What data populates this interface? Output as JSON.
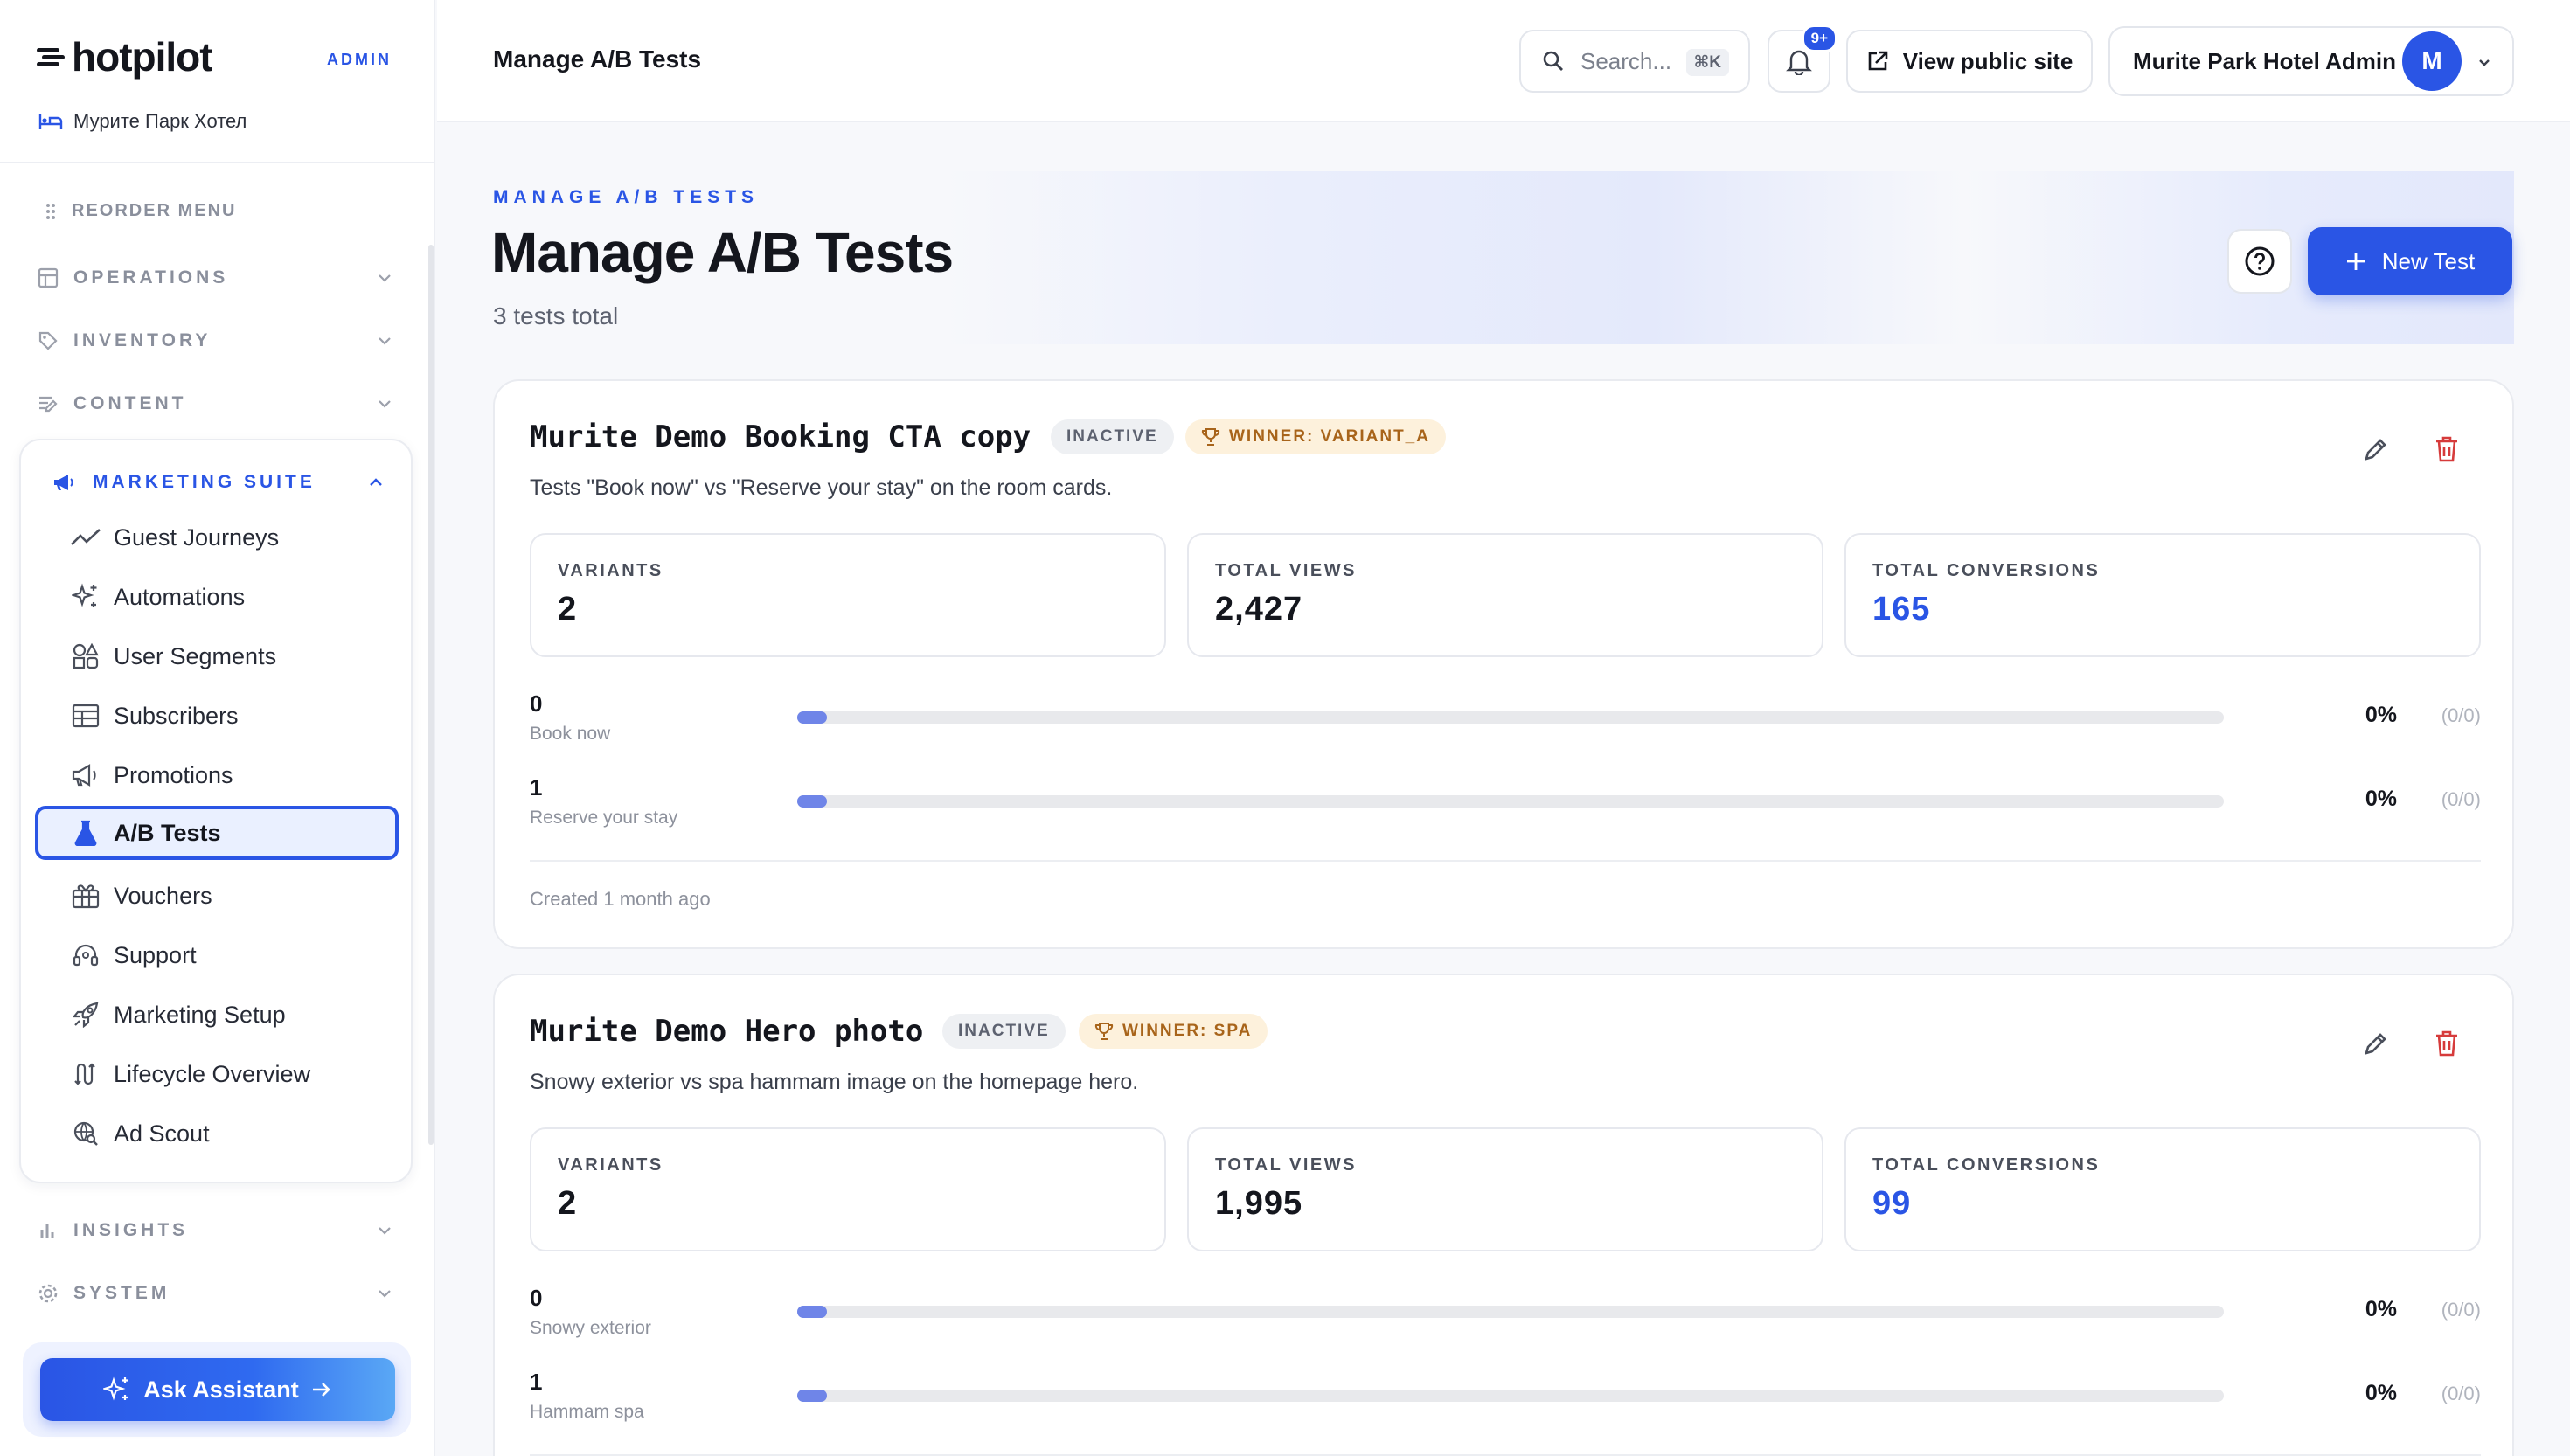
{
  "sidebar": {
    "brand": "hotpilot",
    "admin_tag": "ADMIN",
    "hotel_name": "Мурите Парк Хотел",
    "reorder_label": "REORDER MENU",
    "sections": {
      "operations": "OPERATIONS",
      "inventory": "INVENTORY",
      "content": "CONTENT",
      "marketing": "MARKETING SUITE",
      "insights": "INSIGHTS",
      "system": "SYSTEM"
    },
    "marketing_items": [
      {
        "label": "Guest Journeys",
        "icon": "trend-icon"
      },
      {
        "label": "Automations",
        "icon": "sparkles-icon"
      },
      {
        "label": "User Segments",
        "icon": "shapes-icon"
      },
      {
        "label": "Subscribers",
        "icon": "table-icon"
      },
      {
        "label": "Promotions",
        "icon": "megaphone-icon"
      },
      {
        "label": "A/B Tests",
        "icon": "flask-icon",
        "active": true
      },
      {
        "label": "Vouchers",
        "icon": "gift-icon"
      },
      {
        "label": "Support",
        "icon": "headset-icon"
      },
      {
        "label": "Marketing Setup",
        "icon": "rocket-icon"
      },
      {
        "label": "Lifecycle Overview",
        "icon": "loop-icon"
      },
      {
        "label": "Ad Scout",
        "icon": "search-globe-icon"
      }
    ],
    "assistant_label": "Ask Assistant"
  },
  "topbar": {
    "title": "Manage A/B Tests",
    "search_placeholder": "Search...",
    "search_shortcut": "⌘K",
    "notif_badge": "9+",
    "public_site_label": "View public site",
    "user_name": "Murite Park Hotel Admin",
    "avatar_initial": "M"
  },
  "hero": {
    "eyebrow": "MANAGE A/B TESTS",
    "title": "Manage A/B Tests",
    "subtitle": "3 tests total",
    "new_button": "New Test"
  },
  "tests": [
    {
      "name": "Murite Demo Booking CTA copy",
      "status": "INACTIVE",
      "winner": "WINNER: VARIANT_A",
      "description": "Tests \"Book now\" vs \"Reserve your stay\" on the room cards.",
      "stats": {
        "variants_label": "VARIANTS",
        "variants": "2",
        "views_label": "TOTAL VIEWS",
        "views": "2,427",
        "conv_label": "TOTAL CONVERSIONS",
        "conversions": "165"
      },
      "variants": [
        {
          "index": "0",
          "name": "Book now",
          "pct": "0%",
          "ratio": "(0/0)",
          "fill": 0
        },
        {
          "index": "1",
          "name": "Reserve your stay",
          "pct": "0%",
          "ratio": "(0/0)",
          "fill": 0
        }
      ],
      "footer": "Created 1 month ago"
    },
    {
      "name": "Murite Demo Hero photo",
      "status": "INACTIVE",
      "winner": "WINNER: SPA",
      "description": "Snowy exterior vs spa hammam image on the homepage hero.",
      "stats": {
        "variants_label": "VARIANTS",
        "variants": "2",
        "views_label": "TOTAL VIEWS",
        "views": "1,995",
        "conv_label": "TOTAL CONVERSIONS",
        "conversions": "99"
      },
      "variants": [
        {
          "index": "0",
          "name": "Snowy exterior",
          "pct": "0%",
          "ratio": "(0/0)",
          "fill": 0
        },
        {
          "index": "1",
          "name": "Hammam spa",
          "pct": "0%",
          "ratio": "(0/0)",
          "fill": 0
        }
      ]
    }
  ],
  "colors": {
    "accent": "#2a55e5",
    "winner_bg": "#fdf1dc",
    "winner_text": "#a8641a",
    "delete": "#d63b3b"
  }
}
